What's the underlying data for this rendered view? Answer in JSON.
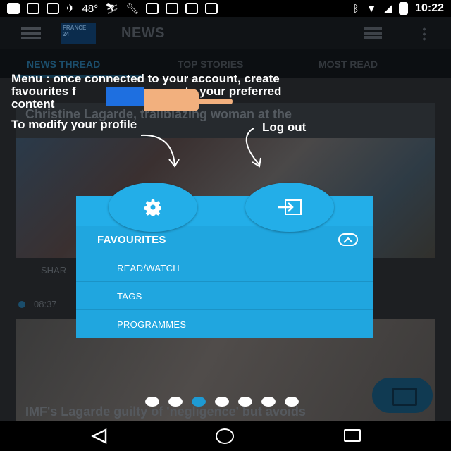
{
  "status_bar": {
    "temperature": "48°",
    "time": "10:22",
    "icons": [
      "messages-icon",
      "flipboard-icon",
      "flipboard-icon",
      "plane-icon",
      "skier-icon",
      "wrench-icon",
      "game-icon",
      "cycle-icon",
      "cat-icon",
      "flipboard-icon",
      "bluetooth-icon",
      "wifi-icon",
      "signal-icon",
      "battery-icon"
    ]
  },
  "app_bar": {
    "logo_text": "FRANCE 24",
    "title": "NEWS"
  },
  "tabs": [
    {
      "label": "NEWS THREAD",
      "active": true
    },
    {
      "label": "TOP STORIES",
      "active": false
    },
    {
      "label": "MOST READ",
      "active": false
    }
  ],
  "content": {
    "card1_title": "Christine Lagarde, trailblazing woman at the",
    "share_label": "SHAR",
    "timestamp": "08:37",
    "card2_title": "IMF's Lagarde guilty of 'negligence' but avoids"
  },
  "overlay": {
    "menu_hint": "Menu : once connected to your account, create favourites f",
    "menu_hint_tail": "to your preferred",
    "menu_hint_line3": "content",
    "profile_hint": "To modify your profile",
    "logout_hint": "Log out"
  },
  "menu": {
    "favourites_label": "FAVOURITES",
    "items": [
      "READ/WATCH",
      "TAGS",
      "PROGRAMMES"
    ]
  },
  "pager": {
    "total": 7,
    "active_index": 2
  },
  "colors": {
    "menu_bg": "#20a6df",
    "accent": "#1e9ad3",
    "background": "#000000"
  }
}
